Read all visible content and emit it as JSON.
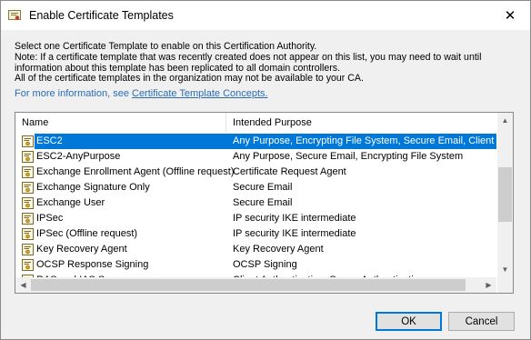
{
  "window": {
    "title": "Enable Certificate Templates",
    "close_glyph": "✕"
  },
  "description": {
    "lines": [
      "Select one Certificate Template to enable on this Certification Authority.",
      "Note: If a certificate template that was recently created does not appear on this list, you may need to wait until",
      "information about this template has been replicated to all domain controllers.",
      "All of the certificate templates in the organization may not be available to your CA."
    ],
    "info_prefix": "For more information, see ",
    "info_link": "Certificate Template Concepts."
  },
  "list": {
    "columns": [
      "Name",
      "Intended Purpose"
    ],
    "rows": [
      {
        "name": "ESC2",
        "purpose": "Any Purpose, Encrypting File System, Secure Email, Client Authentication",
        "selected": true
      },
      {
        "name": "ESC2-AnyPurpose",
        "purpose": "Any Purpose, Secure Email, Encrypting File System"
      },
      {
        "name": "Exchange Enrollment Agent (Offline request)",
        "purpose": "Certificate Request Agent"
      },
      {
        "name": "Exchange Signature Only",
        "purpose": "Secure Email"
      },
      {
        "name": "Exchange User",
        "purpose": "Secure Email"
      },
      {
        "name": "IPSec",
        "purpose": "IP security IKE intermediate"
      },
      {
        "name": "IPSec (Offline request)",
        "purpose": "IP security IKE intermediate"
      },
      {
        "name": "Key Recovery Agent",
        "purpose": "Key Recovery Agent"
      },
      {
        "name": "OCSP Response Signing",
        "purpose": "OCSP Signing"
      },
      {
        "name": "RAS and IAS Server",
        "purpose": "Client Authentication, Server Authentication"
      }
    ],
    "row_icon": "certificate-template-icon",
    "selection_color": "#0078d7"
  },
  "buttons": {
    "ok": "OK",
    "cancel": "Cancel"
  }
}
